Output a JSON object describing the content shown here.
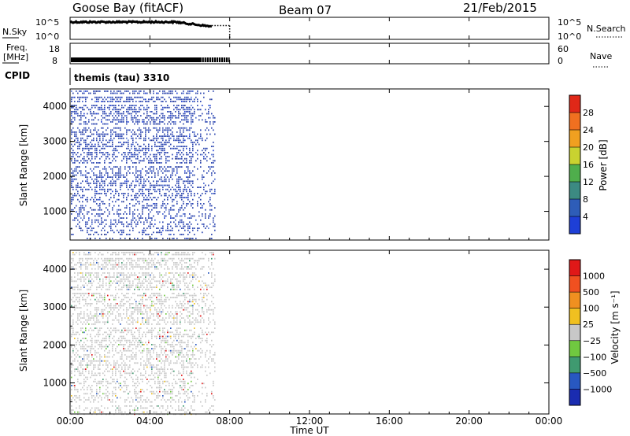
{
  "header": {
    "station": "Goose Bay (fitACF)",
    "beam": "Beam 07",
    "date": "21/Feb/2015"
  },
  "left_labels": {
    "nsky": "N.Sky",
    "freq_line1": "Freq.",
    "freq_line2": "[MHz]",
    "cpid": "CPID"
  },
  "right_labels": {
    "nsearch": "N.Search",
    "nave": "Nave"
  },
  "cpid_text": "themis (tau) 3310",
  "chart_data": [
    {
      "type": "line",
      "name": "noise-panel",
      "ylabel": "N.Sky",
      "y2label": "N.Search",
      "yticks": [
        "10^5",
        "10^0"
      ],
      "y2ticks": [
        "10^5",
        "10^0"
      ],
      "xlim": [
        0,
        24
      ],
      "series_color": "#000000",
      "data_end_hour": 8.0
    },
    {
      "type": "line",
      "name": "freq-panel",
      "ylabel": "Freq. [MHz]",
      "y2label": "Nave",
      "yticks": [
        "18",
        "8"
      ],
      "y2ticks": [
        "60",
        "0"
      ],
      "ylim": [
        8,
        18
      ],
      "y2lim": [
        0,
        60
      ],
      "freq_mhz": 8,
      "data_end_hour": 8.0
    },
    {
      "type": "heatmap",
      "name": "power-panel",
      "ylabel": "Slant Range [km]",
      "yticks": [
        "1000",
        "2000",
        "3000",
        "4000"
      ],
      "ylim": [
        180,
        4500
      ],
      "xlim": [
        0,
        24
      ],
      "data_start_hour": 0.0,
      "data_end_hour": 7.25,
      "colorbar": {
        "label": "Power [dB]",
        "ticks": [
          "4",
          "8",
          "12",
          "16",
          "20",
          "24",
          "28"
        ],
        "range": [
          0,
          30
        ],
        "colors": [
          "#1e3fd6",
          "#2e5db8",
          "#3c8a82",
          "#4fae4c",
          "#c9d230",
          "#f0a020",
          "#f07020",
          "#e02818"
        ]
      },
      "dominant_color": "#2b45b0"
    },
    {
      "type": "heatmap",
      "name": "velocity-panel",
      "ylabel": "Slant Range [km]",
      "yticks": [
        "1000",
        "2000",
        "3000",
        "4000"
      ],
      "ylim": [
        180,
        4500
      ],
      "xlim": [
        0,
        24
      ],
      "data_start_hour": 0.0,
      "data_end_hour": 7.25,
      "colorbar": {
        "label": "Velocity [m s⁻¹]",
        "ticks": [
          "1000",
          "500",
          "100",
          "25",
          "−25",
          "−100",
          "−500",
          "−1000"
        ],
        "colors": [
          "#1a2cb0",
          "#2858c0",
          "#3f9a70",
          "#70c840",
          "#c8c8c8",
          "#f0c020",
          "#f09020",
          "#f05020",
          "#e01818"
        ]
      },
      "dominant_color": "#c8c8c8"
    }
  ],
  "x_axis": {
    "ticks": [
      "00:00",
      "04:00",
      "08:00",
      "12:00",
      "16:00",
      "20:00",
      "00:00"
    ],
    "label": "Time UT"
  }
}
